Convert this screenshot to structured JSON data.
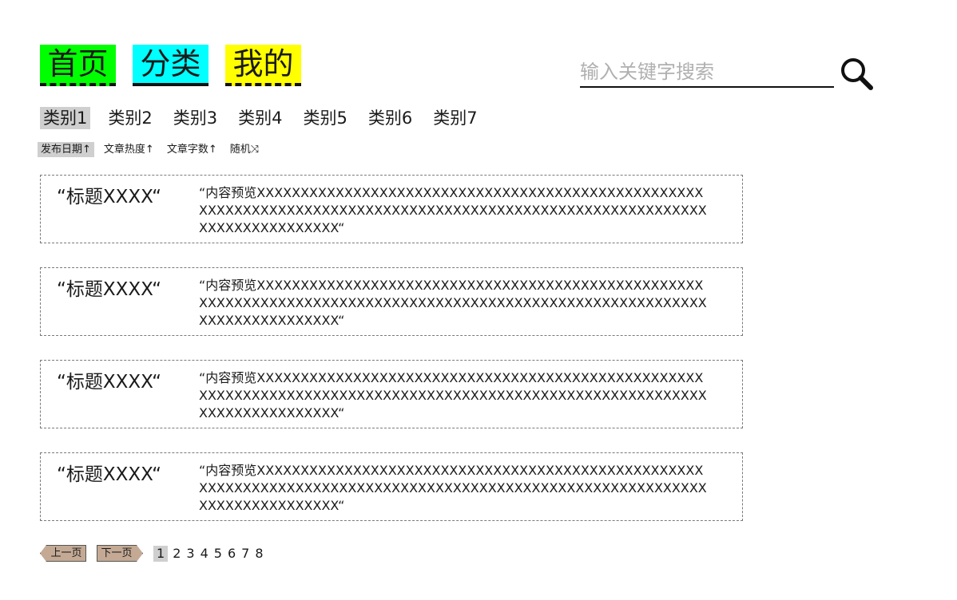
{
  "nav": {
    "home_label": "首页",
    "category_label": "分类",
    "mine_label": "我的",
    "colors": {
      "home": "#00ff00",
      "category": "#00ffff",
      "mine": "#ffff00"
    }
  },
  "search": {
    "placeholder": "输入关键字搜索",
    "value": "",
    "icon": "search-icon"
  },
  "categories": {
    "items": [
      "类别1",
      "类别2",
      "类别3",
      "类别4",
      "类别5",
      "类别6",
      "类别7"
    ],
    "active_index": 0
  },
  "sort": {
    "items": [
      "发布日期↑",
      "文章热度↑",
      "文章字数↑",
      "随机⤨"
    ],
    "active_index": 0
  },
  "articles": [
    {
      "title": "“标题XXXX“",
      "preview": "“内容预览XXXXXXXXXXXXXXXXXXXXXXXXXXXXXXXXXXXXXXXXXXXXXXXXXXXXXXXXXXXXXXXXXXXXXXXXXXXXXXXXXXXXXXXXXXXXXXXXXXXXXXXXXXXXXXXXXXXXXXXXXXXXX“"
    },
    {
      "title": "“标题XXXX“",
      "preview": "“内容预览XXXXXXXXXXXXXXXXXXXXXXXXXXXXXXXXXXXXXXXXXXXXXXXXXXXXXXXXXXXXXXXXXXXXXXXXXXXXXXXXXXXXXXXXXXXXXXXXXXXXXXXXXXXXXXXXXXXXXXXXXXXXX“"
    },
    {
      "title": "“标题XXXX“",
      "preview": "“内容预览XXXXXXXXXXXXXXXXXXXXXXXXXXXXXXXXXXXXXXXXXXXXXXXXXXXXXXXXXXXXXXXXXXXXXXXXXXXXXXXXXXXXXXXXXXXXXXXXXXXXXXXXXXXXXXXXXXXXXXXXXXXXX“"
    },
    {
      "title": "“标题XXXX“",
      "preview": "“内容预览XXXXXXXXXXXXXXXXXXXXXXXXXXXXXXXXXXXXXXXXXXXXXXXXXXXXXXXXXXXXXXXXXXXXXXXXXXXXXXXXXXXXXXXXXXXXXXXXXXXXXXXXXXXXXXXXXXXXXXXXXXXXX“"
    }
  ],
  "pagination": {
    "prev_label": "上一页",
    "next_label": "下一页",
    "pages": [
      "1",
      "2",
      "3",
      "4",
      "5",
      "6",
      "7",
      "8"
    ],
    "active_index": 0,
    "button_color": "#c4aa95"
  }
}
